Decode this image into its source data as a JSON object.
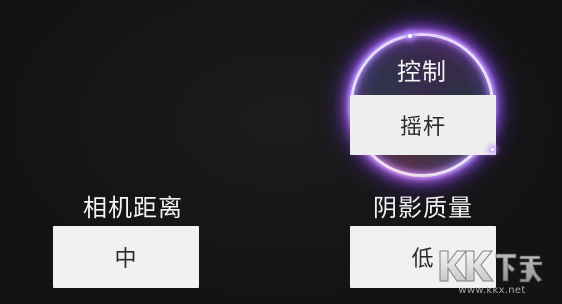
{
  "settings": {
    "control": {
      "label": "控制",
      "value": "摇杆"
    },
    "camera_distance": {
      "label": "相机距离",
      "value": "中"
    },
    "shadow_quality": {
      "label": "阴影质量",
      "value": "低"
    }
  },
  "watermark": {
    "logo_text": "KK下载",
    "url": "www.kkx.net"
  },
  "colors": {
    "background": "#131313",
    "label_text": "#f4f4f4",
    "value_box": "#f1f1f1",
    "value_text": "#2b2b2b",
    "ring_glow": "#a86cff"
  }
}
